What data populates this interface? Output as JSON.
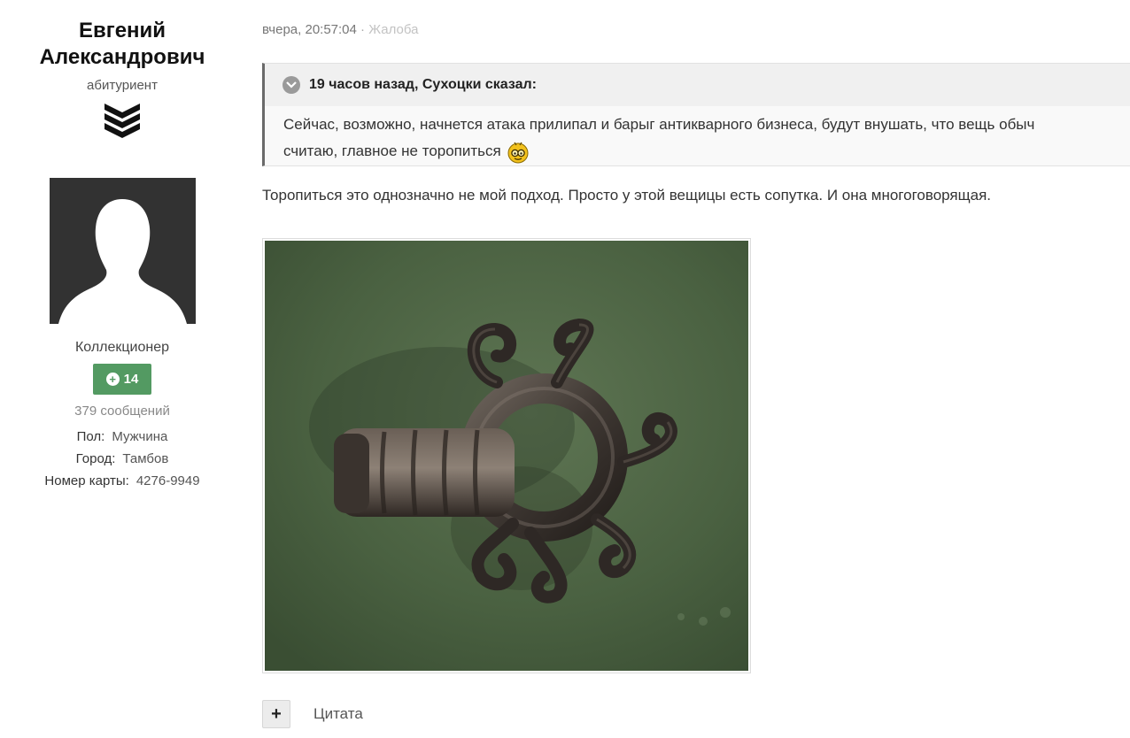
{
  "author": {
    "name_line1": "Евгений",
    "name_line2": "Александрович",
    "title": "абитуриент",
    "rank_icon": "chevrons-rank-icon",
    "group": "Коллекционер",
    "reputation": "14",
    "post_count": "379 сообщений",
    "fields": [
      {
        "label": "Пол:",
        "value": "Мужчина"
      },
      {
        "label": "Город:",
        "value": "Тамбов"
      },
      {
        "label": "Номер карты:",
        "value": "4276-9949"
      }
    ],
    "badge_color": "#539a62"
  },
  "post": {
    "timestamp": "вчера, 20:57:04",
    "separator": "·",
    "report_label": "Жалоба",
    "quote": {
      "header": "19 часов назад, Сухоцки сказал:",
      "line1": "Сейчас, возможно, начнется атака прилипал и барыг антикварного бизнеса, будут внушать, что вещь обыч",
      "line2": "считаю, главное не торопиться",
      "emoji": "smiley-glasses-icon"
    },
    "reply": "Торопиться это однозначно не мой подход. Просто у этой вещицы есть сопутка. И она многоговорящая.",
    "image_subject": "bronze-ring-artifact-photo"
  },
  "actions": {
    "plus_label": "+",
    "quote_label": "Цитата"
  }
}
